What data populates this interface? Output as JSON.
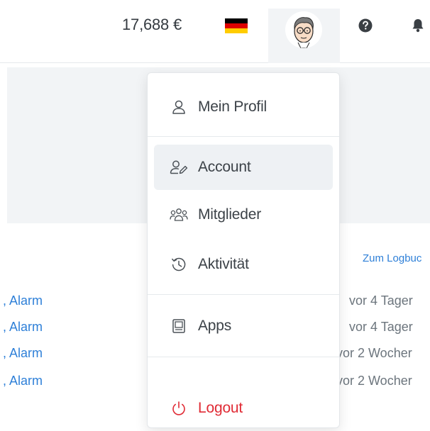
{
  "header": {
    "balance": "17,688 €",
    "flag_colors": [
      "#000000",
      "#dd0000",
      "#ffcc00"
    ],
    "flag_icon": "german-flag-icon",
    "avatar_icon": "user-avatar-icon",
    "help_icon": "help-circle-icon",
    "notifications_icon": "bell-icon"
  },
  "background": {
    "logbuch_link": "Zum Logbuc",
    "rows": [
      {
        "label": ", Alarm",
        "time": "vor 4 Tager"
      },
      {
        "label": ", Alarm",
        "time": "vor 4 Tager"
      },
      {
        "label": ", Alarm",
        "time": "vor 2 Wocher"
      },
      {
        "label": ", Alarm",
        "time": "vor 2 Wocher"
      }
    ]
  },
  "menu": {
    "items": [
      {
        "label": "Mein Profil",
        "icon": "user-icon"
      },
      {
        "label": "Account",
        "icon": "user-edit-icon"
      },
      {
        "label": "Mitglieder",
        "icon": "users-icon"
      },
      {
        "label": "Aktivität",
        "icon": "history-icon"
      },
      {
        "label": "Apps",
        "icon": "apps-icon"
      },
      {
        "label": "Logout",
        "icon": "power-icon"
      }
    ]
  },
  "colors": {
    "accent_link": "#2f80d8",
    "logout": "#e02b35",
    "active_bg": "#eef1f4"
  }
}
